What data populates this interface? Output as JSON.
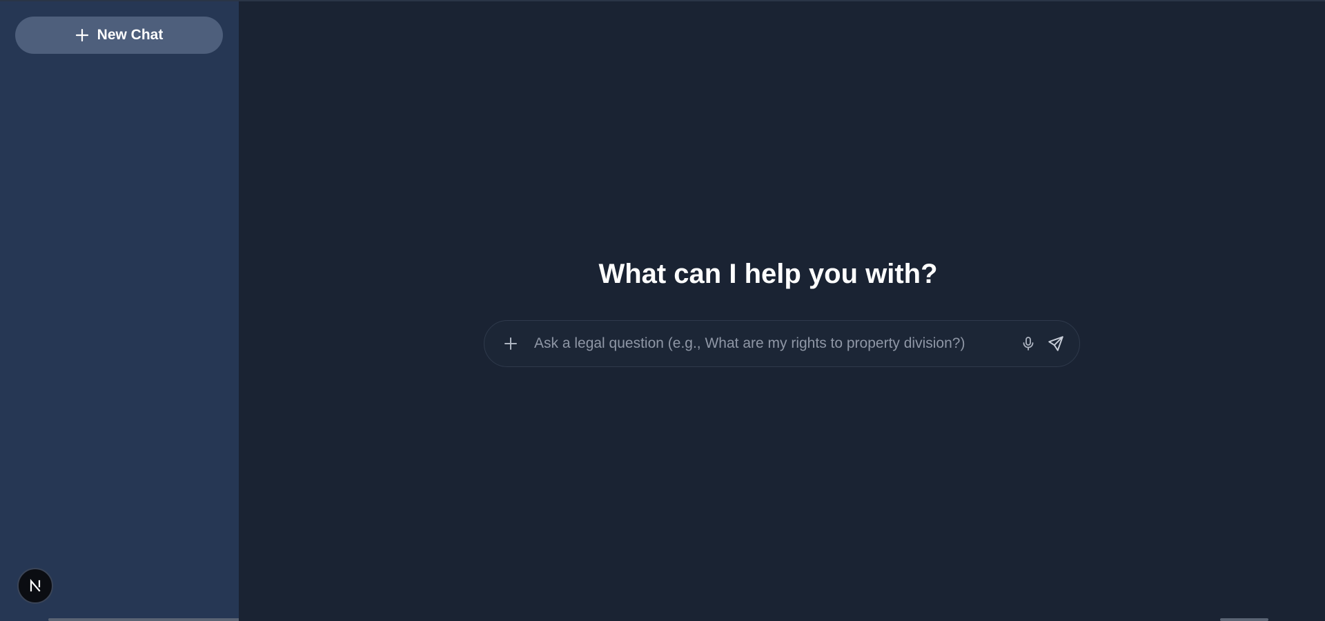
{
  "sidebar": {
    "new_chat_label": "New Chat",
    "avatar_letter": "N"
  },
  "main": {
    "headline": "What can I help you with?",
    "composer": {
      "placeholder": "Ask a legal question (e.g., What are my rights to property division?)",
      "value": ""
    }
  },
  "icons": {
    "new_chat": "plus-icon",
    "attach": "plus-icon",
    "mic": "microphone-icon",
    "send": "send-icon"
  },
  "colors": {
    "sidebar_bg": "#263754",
    "main_bg": "#1a2333",
    "button_bg": "#4e5f7c"
  }
}
